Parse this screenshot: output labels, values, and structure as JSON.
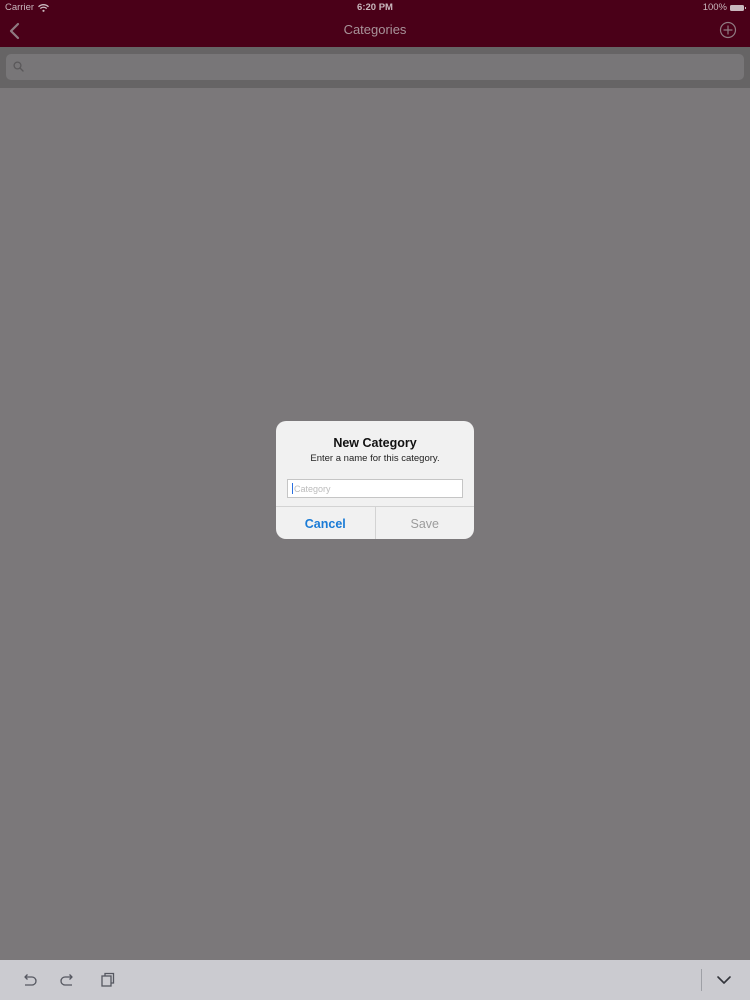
{
  "status_bar": {
    "carrier": "Carrier",
    "time": "6:20 PM",
    "battery": "100%"
  },
  "nav": {
    "title": "Categories",
    "back_icon": "chevron-left-icon",
    "add_icon": "plus-circle-icon"
  },
  "search": {
    "icon": "search-icon",
    "placeholder": ""
  },
  "alert": {
    "title": "New Category",
    "message": "Enter a name for this category.",
    "field_placeholder": "Category",
    "field_value": "",
    "cancel_label": "Cancel",
    "save_label": "Save"
  },
  "toolbar": {
    "icons": [
      "undo-icon",
      "redo-icon",
      "paste-icon",
      "keyboard-dismiss-icon"
    ]
  },
  "colors": {
    "nav_background": "#4a0018",
    "dim_overlay": "#7b787a",
    "accent_blue": "#1a7bd6",
    "disabled_gray": "#9c9c9c"
  }
}
